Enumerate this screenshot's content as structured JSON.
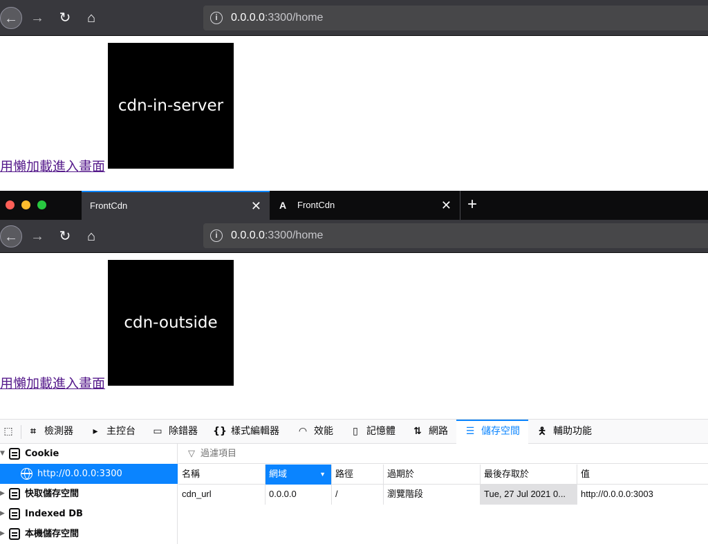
{
  "top_window": {
    "url_host": "0.0.0.0",
    "url_rest": ":3300/home",
    "link_text": "用懶加載進入畫面",
    "box_text": "cdn-in-server"
  },
  "bottom_window": {
    "tabs": [
      {
        "title": "FrontCdn",
        "active": true
      },
      {
        "title": "FrontCdn",
        "active": false
      }
    ],
    "url_host": "0.0.0.0",
    "url_rest": ":3300/home",
    "link_text": "用懶加載進入畫面",
    "box_text": "cdn-outside"
  },
  "devtools": {
    "tabs": [
      {
        "label": "檢測器",
        "icon": "inspector-icon"
      },
      {
        "label": "主控台",
        "icon": "console-icon"
      },
      {
        "label": "除錯器",
        "icon": "debugger-icon"
      },
      {
        "label": "樣式編輯器",
        "icon": "style-editor-icon"
      },
      {
        "label": "效能",
        "icon": "performance-icon"
      },
      {
        "label": "記憶體",
        "icon": "memory-icon"
      },
      {
        "label": "網路",
        "icon": "network-icon"
      },
      {
        "label": "儲存空間",
        "icon": "storage-icon"
      },
      {
        "label": "輔助功能",
        "icon": "accessibility-icon"
      }
    ],
    "selected_tab": "儲存空間",
    "tree": [
      {
        "label": "Cookie",
        "expanded": true
      },
      {
        "label": "http://0.0.0.0:3300",
        "child": true,
        "selected": true
      },
      {
        "label": "快取儲存空間"
      },
      {
        "label": "Indexed DB"
      },
      {
        "label": "本機儲存空間"
      }
    ],
    "filter_placeholder": "過濾項目",
    "columns": [
      "名稱",
      "網域",
      "路徑",
      "過期於",
      "最後存取於",
      "值"
    ],
    "sorted_column": "網域",
    "rows": [
      [
        "cdn_url",
        "0.0.0.0",
        "/",
        "瀏覽階段",
        "Tue, 27 Jul 2021 0...",
        "http://0.0.0.0:3003"
      ]
    ]
  },
  "colors": {
    "accent": "#0a84ff",
    "link_visited": "#551a8b",
    "toolbar_dark": "#38383d"
  }
}
